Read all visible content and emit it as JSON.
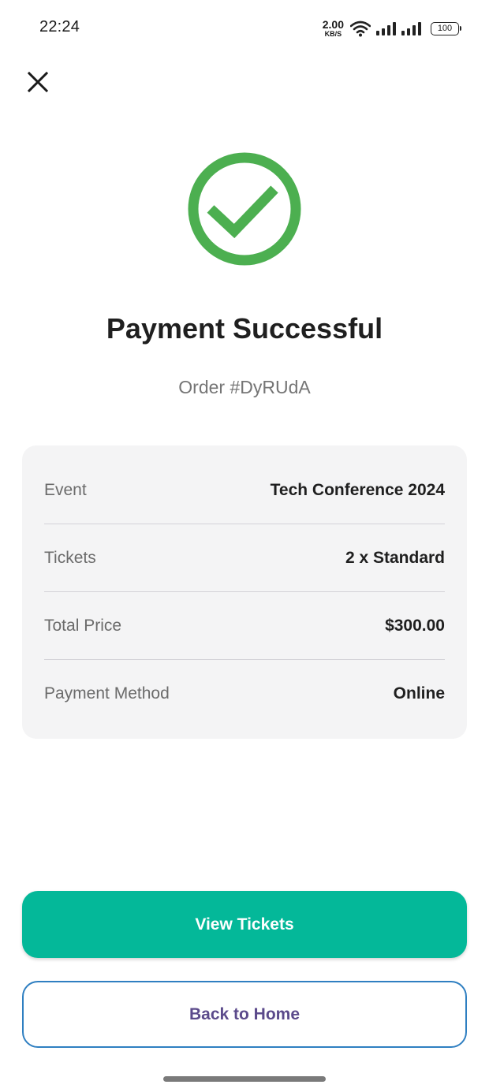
{
  "status_bar": {
    "time": "22:24",
    "net_speed_value": "2.00",
    "net_speed_unit": "KB/S",
    "battery_level": "100",
    "icons": [
      "wifi-icon",
      "signal-icon",
      "signal-icon",
      "battery-icon"
    ]
  },
  "header": {
    "close_icon": "close-icon"
  },
  "success": {
    "icon": "check-circle-icon",
    "color": "#4caf50",
    "title": "Payment Successful",
    "order_number": "Order #DyRUdA"
  },
  "details": {
    "rows": [
      {
        "label": "Event",
        "value": "Tech Conference 2024"
      },
      {
        "label": "Tickets",
        "value": "2 x Standard"
      },
      {
        "label": "Total Price",
        "value": "$300.00"
      },
      {
        "label": "Payment Method",
        "value": "Online"
      }
    ]
  },
  "actions": {
    "view_tickets_label": "View Tickets",
    "back_home_label": "Back to Home",
    "primary_color": "#04b899",
    "secondary_border_color": "#2f7fc1",
    "secondary_text_color": "#5b4a8b"
  }
}
